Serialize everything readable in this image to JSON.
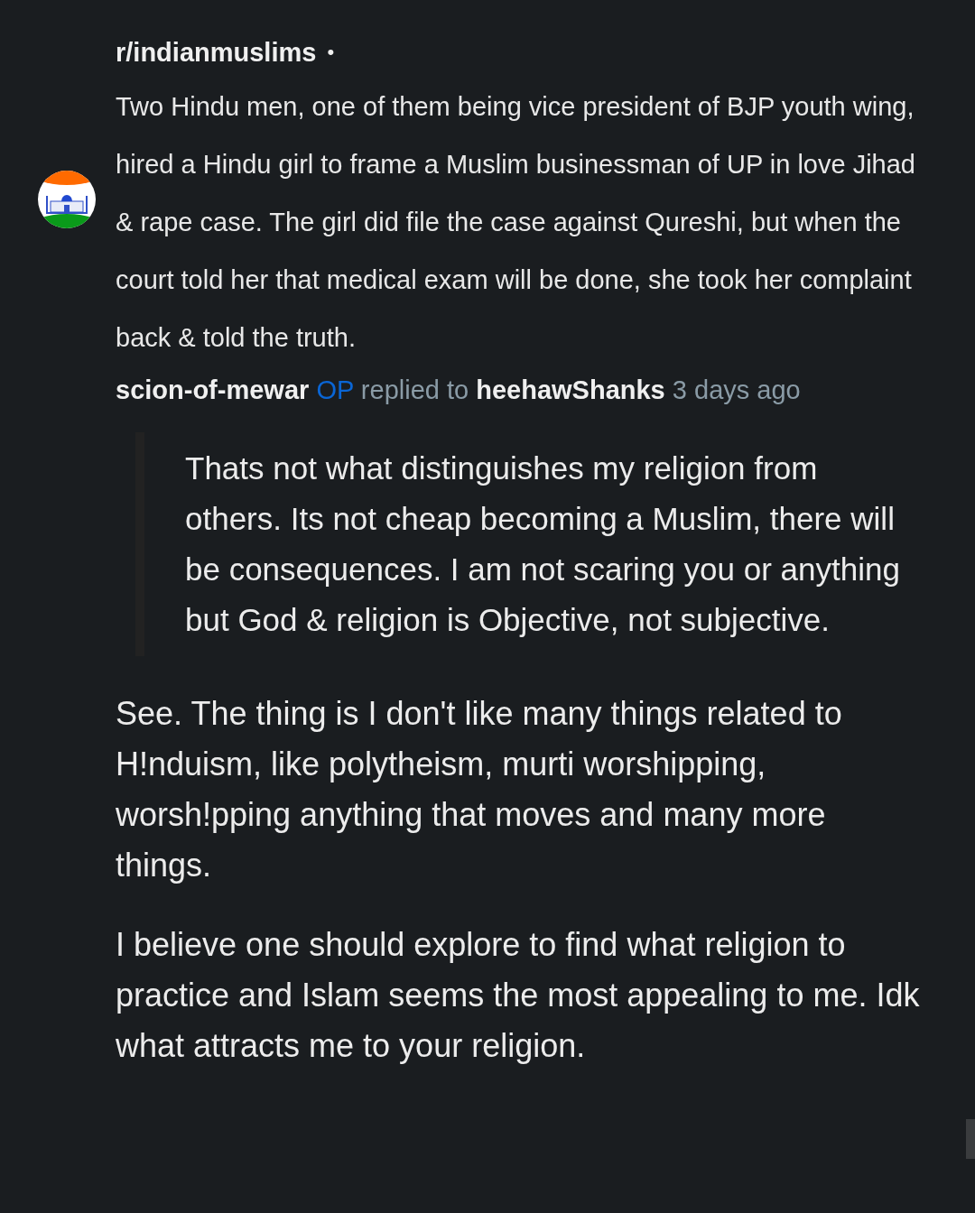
{
  "post": {
    "subreddit": "r/indianmuslims",
    "separator": "•",
    "body": "Two Hindu men, one of them being vice president of BJP youth wing, hired a Hindu girl to frame a Muslim businessman of UP in love Jihad & rape case. The girl did file the case against Qureshi, but when the court told her that medical exam will be done, she took her complaint back & told the truth."
  },
  "comment": {
    "author": "scion-of-mewar",
    "op_badge": "OP",
    "replied_to_label": "replied to",
    "parent_author": "heehawShanks",
    "time": "3 days ago",
    "quote": "Thats not what distinguishes my religion from others. Its not cheap becoming a Muslim, there will be consequences. I am not scaring you or anything but God & religion is Objective, not subjective.",
    "paragraphs": [
      "See. The thing is I don't like many things related to H!nduism, like polytheism, murti worshipping, worsh!pping anything that moves and many more things.",
      "I believe one should explore to find what religion to practice and Islam seems the most appealing to me. Idk what attracts me to your religion."
    ]
  }
}
